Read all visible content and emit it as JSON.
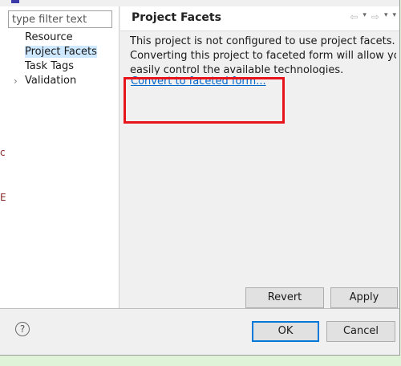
{
  "filter": {
    "placeholder": "type filter text"
  },
  "tree": {
    "items": [
      {
        "label": "Resource",
        "selected": false,
        "expandable": false
      },
      {
        "label": "Project Facets",
        "selected": true,
        "expandable": false
      },
      {
        "label": "Task Tags",
        "selected": false,
        "expandable": false
      },
      {
        "label": "Validation",
        "selected": false,
        "expandable": true,
        "chevron": "›"
      }
    ]
  },
  "left_edge_marks": [
    "c",
    "E"
  ],
  "page": {
    "title": "Project Facets",
    "nav": [
      "⇦",
      "▾",
      "⇨",
      "▾",
      "▾"
    ],
    "description_lines": [
      "This project is not configured to use project facets.",
      "Converting this project to faceted form will allow you to",
      "easily control the available technologies."
    ],
    "convert_link": "Convert to faceted form...",
    "highlight_color": "#e8141b"
  },
  "buttons": {
    "revert": "Revert",
    "apply": "Apply",
    "ok": "OK",
    "cancel": "Cancel"
  },
  "help": {
    "glyph": "?"
  }
}
